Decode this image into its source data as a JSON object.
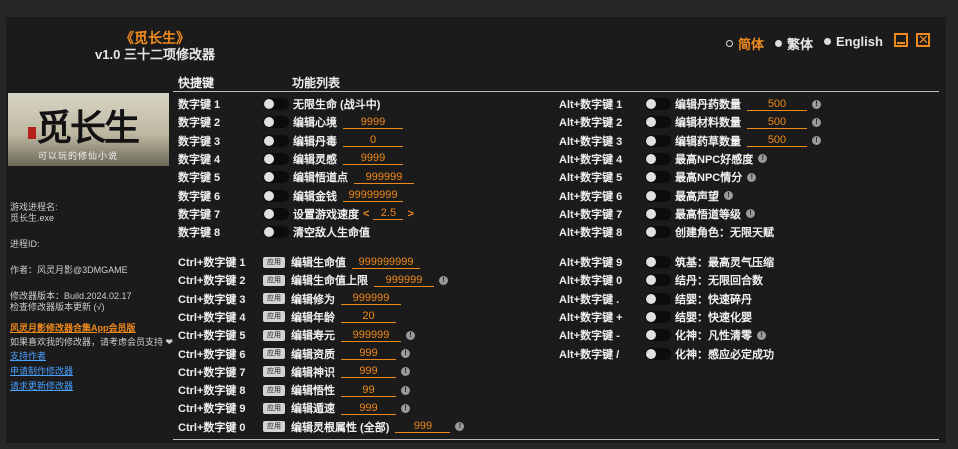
{
  "header": {
    "title": "《觅长生》",
    "subtitle": "v1.0 三十二项修改器"
  },
  "languages": [
    {
      "label": "简体",
      "selected": true
    },
    {
      "label": "繁体",
      "selected": false
    },
    {
      "label": "English",
      "selected": false
    }
  ],
  "columns": {
    "hotkey": "快捷键",
    "functions": "功能列表"
  },
  "banner": {
    "title": "觅长生",
    "slogan": "可以玩的修仙小说"
  },
  "sidebar": {
    "process_label": "游戏进程名:",
    "process_name": "觅长生.exe",
    "pid_label": "进程ID:",
    "author": "作者：风灵月影@3DMGAME",
    "version": "修改器版本：Build.2024.02.17",
    "check_update": "检查修改器版本更新 (√)",
    "promo": "风灵月影修改器合集App会员版",
    "support_text": "如果喜欢我的修改器，请考虑会员支持 ❤",
    "support_link": "支持作者",
    "request_link": "申请制作修改器",
    "update_link": "请求更新修改器"
  },
  "left_toggles": [
    {
      "key": "数字键 1",
      "label": "无限生命 (战斗中)"
    },
    {
      "key": "数字键 2",
      "label": "编辑心境",
      "value": "9999"
    },
    {
      "key": "数字键 3",
      "label": "编辑丹毒",
      "value": "0"
    },
    {
      "key": "数字键 4",
      "label": "编辑灵感",
      "value": "9999"
    },
    {
      "key": "数字键 5",
      "label": "编辑悟道点",
      "value": "999999"
    },
    {
      "key": "数字键 6",
      "label": "编辑金钱",
      "value": "99999999"
    },
    {
      "key": "数字键 7",
      "label": "设置游戏速度",
      "value": "2.5",
      "arrows": true
    },
    {
      "key": "数字键 8",
      "label": "清空敌人生命值"
    }
  ],
  "left_apply": [
    {
      "key": "Ctrl+数字键 1",
      "apply": "应用",
      "label": "编辑生命值",
      "value": "999999999"
    },
    {
      "key": "Ctrl+数字键 2",
      "apply": "应用",
      "label": "编辑生命值上限",
      "value": "999999",
      "info": true
    },
    {
      "key": "Ctrl+数字键 3",
      "apply": "应用",
      "label": "编辑修为",
      "value": "999999"
    },
    {
      "key": "Ctrl+数字键 4",
      "apply": "应用",
      "label": "编辑年龄",
      "value": "20"
    },
    {
      "key": "Ctrl+数字键 5",
      "apply": "应用",
      "label": "编辑寿元",
      "value": "999999",
      "info": true
    },
    {
      "key": "Ctrl+数字键 6",
      "apply": "应用",
      "label": "编辑资质",
      "value": "999",
      "info": true
    },
    {
      "key": "Ctrl+数字键 7",
      "apply": "应用",
      "label": "编辑神识",
      "value": "999",
      "info": true
    },
    {
      "key": "Ctrl+数字键 8",
      "apply": "应用",
      "label": "编辑悟性",
      "value": "99",
      "info": true
    },
    {
      "key": "Ctrl+数字键 9",
      "apply": "应用",
      "label": "编辑遁速",
      "value": "999",
      "info": true
    },
    {
      "key": "Ctrl+数字键 0",
      "apply": "应用",
      "label": "编辑灵根属性 (全部)",
      "value": "999",
      "info": true
    }
  ],
  "right_toggles": [
    {
      "key": "Alt+数字键 1",
      "label": "编辑丹药数量",
      "value": "500",
      "info": true
    },
    {
      "key": "Alt+数字键 2",
      "label": "编辑材料数量",
      "value": "500",
      "info": true
    },
    {
      "key": "Alt+数字键 3",
      "label": "编辑药草数量",
      "value": "500",
      "info": true
    },
    {
      "key": "Alt+数字键 4",
      "label": "最高NPC好感度",
      "info": true
    },
    {
      "key": "Alt+数字键 5",
      "label": "最高NPC情分",
      "info": true
    },
    {
      "key": "Alt+数字键 6",
      "label": "最高声望",
      "info": true
    },
    {
      "key": "Alt+数字键 7",
      "label": "最高悟道等级",
      "info": true
    },
    {
      "key": "Alt+数字键 8",
      "label": "创建角色：无限天赋"
    }
  ],
  "right_toggles2": [
    {
      "key": "Alt+数字键 9",
      "label": "筑基：最高灵气压缩"
    },
    {
      "key": "Alt+数字键 0",
      "label": "结丹：无限回合数"
    },
    {
      "key": "Alt+数字键 .",
      "label": "结婴：快速碎丹"
    },
    {
      "key": "Alt+数字键 +",
      "label": "结婴：快速化婴"
    },
    {
      "key": "Alt+数字键 -",
      "label": "化神：凡性清零",
      "info": true
    },
    {
      "key": "Alt+数字键 /",
      "label": "化神：感应必定成功"
    }
  ],
  "colors": {
    "accent": "#f08a1c",
    "background": "#1b1b1b"
  }
}
